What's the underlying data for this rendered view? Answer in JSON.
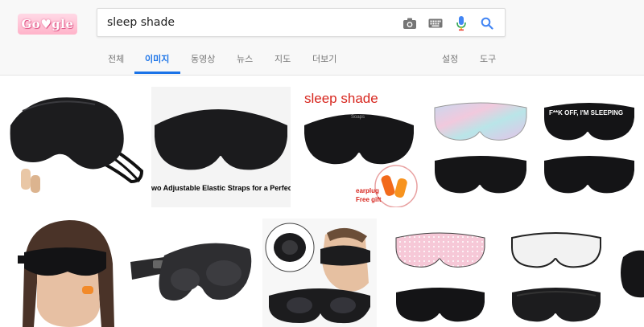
{
  "logo": {
    "text": "Go♥gle"
  },
  "search": {
    "query": "sleep shade"
  },
  "icons": {
    "camera": "camera-icon",
    "keyboard": "keyboard-icon",
    "mic": "mic-icon",
    "search": "search-icon"
  },
  "tabs": [
    {
      "label": "전체"
    },
    {
      "label": "이미지"
    },
    {
      "label": "동영상"
    },
    {
      "label": "뉴스"
    },
    {
      "label": "지도"
    },
    {
      "label": "더보기"
    },
    {
      "label": "설정"
    },
    {
      "label": "도구"
    }
  ],
  "results": {
    "img2_caption": "wo Adjustable Elastic Straps for a Perfect F",
    "img3_title": "sleep shade",
    "img3_brand": "Soaps",
    "img3_gift1": "earplug",
    "img3_gift2": "Free gift",
    "img5_text": "F**K OFF, I'M SLEEPING"
  },
  "colors": {
    "accent": "#1a73e8",
    "mask": "#1c1c1e",
    "title_red": "#d7261e"
  }
}
